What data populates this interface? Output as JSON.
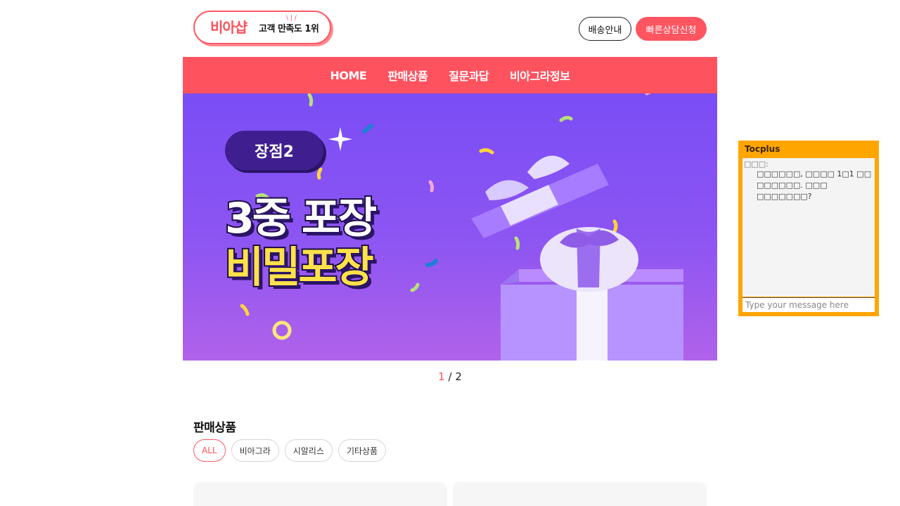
{
  "header": {
    "brand": "비아샵",
    "slogan": "고객 만족도 1위",
    "shipping_button": "배송안내",
    "consult_button": "빠른상담신청"
  },
  "nav": {
    "items": [
      "HOME",
      "판매상품",
      "질문과답",
      "비아그라정보"
    ]
  },
  "banner": {
    "badge": "장점2",
    "headline_line1": "3중 포장",
    "headline_line2": "비밀포장",
    "slide_current": "1",
    "slide_separator": "/",
    "slide_total": "2"
  },
  "products": {
    "title": "판매상품",
    "filters": [
      "ALL",
      "비아그라",
      "시알리스",
      "기타상품"
    ],
    "active_filter": "ALL"
  },
  "chat": {
    "title": "Tocplus",
    "sender": "□□□:",
    "message": "□□□□□□, □□□□ 1□1 □□ □□□□□□. □□□ □□□□□□□?",
    "input_placeholder": "Type your message here"
  },
  "colors": {
    "accent": "#ff525f",
    "banner_top": "#7a4df5",
    "banner_bottom": "#b062ea",
    "headline_yellow": "#ffe14a",
    "chat_frame": "#ffa500"
  }
}
